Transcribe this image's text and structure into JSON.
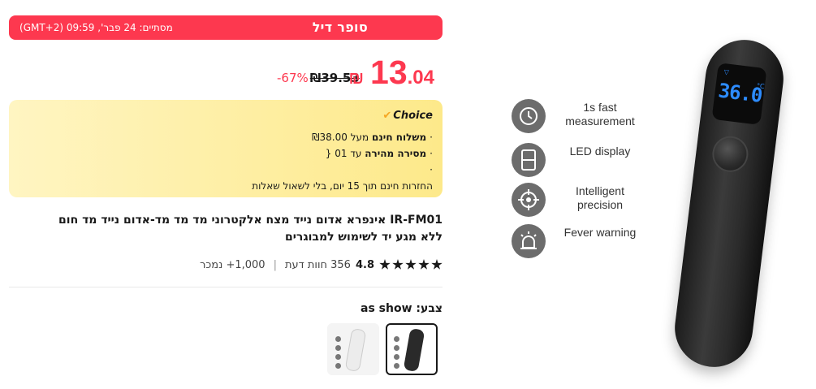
{
  "deal": {
    "title": "סופר דיל",
    "ends_label": "מסתיים:",
    "ends_time": "24 פבר', 09:59 (GMT+2)"
  },
  "price": {
    "integer": "13",
    "decimal": ".04",
    "currency": "₪",
    "old_price": "₪39.53",
    "discount": "-67%"
  },
  "choice": {
    "badge": "Choice",
    "items": [
      {
        "bold": "משלוח חינם",
        "text": "מעל ₪38.00"
      },
      {
        "bold": "מסירה מהירה",
        "text": "עד 01 {"
      },
      {
        "bold": "",
        "text": ""
      },
      {
        "bold": "",
        "text": "החזרות חינם תוך 15 יום, בלי לשאול שאלות"
      }
    ]
  },
  "product": {
    "title": "IR-FM01 אינפרא אדום נייד מצח אלקטרוני מד מד מד-אדום נייד מד חום ללא מגע יד לשימוש למבוגרים"
  },
  "rating": {
    "score": "4.8",
    "stars": 5,
    "reviews": "356 חוות דעת",
    "sold": "1,000+ נמכר"
  },
  "color": {
    "label": "צבע:",
    "value": "as show"
  },
  "gallery": {
    "features": [
      {
        "icon": "clock-icon",
        "text": "1s fast measurement"
      },
      {
        "icon": "led-digit-icon",
        "text": "LED display"
      },
      {
        "icon": "crosshair-icon",
        "text": "Intelligent precision"
      },
      {
        "icon": "alarm-icon",
        "text": "Fever warning"
      }
    ],
    "display_temp": "36.0",
    "display_unit": "°C"
  },
  "colors": {
    "accent": "#fd384f",
    "choice_bg": "#fde98a",
    "text": "#191919"
  }
}
